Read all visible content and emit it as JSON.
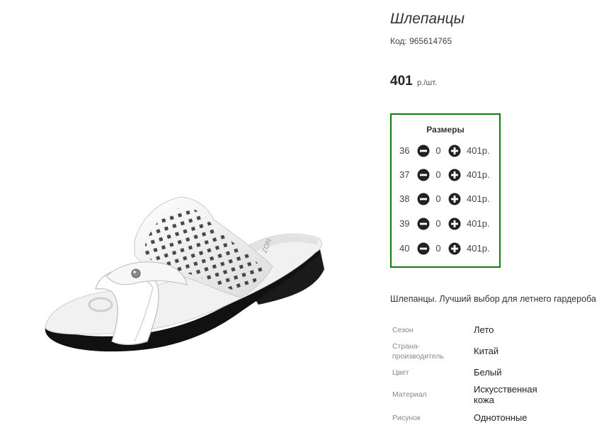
{
  "product": {
    "title": "Шлепанцы",
    "code": "Код: 965614765",
    "price": "401",
    "price_unit": "р./шт.",
    "image": "white-slide-sandal-image",
    "description": "Шлепанцы. Лучший выбор для летнего гардероба"
  },
  "sizes": {
    "title": "Размеры",
    "border_color": "#0f7c0f",
    "rows": [
      {
        "size": "36",
        "qty": "0",
        "price": "401р."
      },
      {
        "size": "37",
        "qty": "0",
        "price": "401р."
      },
      {
        "size": "38",
        "qty": "0",
        "price": "401р."
      },
      {
        "size": "39",
        "qty": "0",
        "price": "401р."
      },
      {
        "size": "40",
        "qty": "0",
        "price": "401р."
      }
    ]
  },
  "properties": [
    {
      "label": "Сезон",
      "value": "Лето"
    },
    {
      "label": "Страна-\nпроизводитель",
      "value": "Китай"
    },
    {
      "label": "Цвет",
      "value": "Белый"
    },
    {
      "label": "Материал",
      "value": "Искусственная\nкожа"
    },
    {
      "label": "Рисунок",
      "value": "Однотонные"
    }
  ]
}
